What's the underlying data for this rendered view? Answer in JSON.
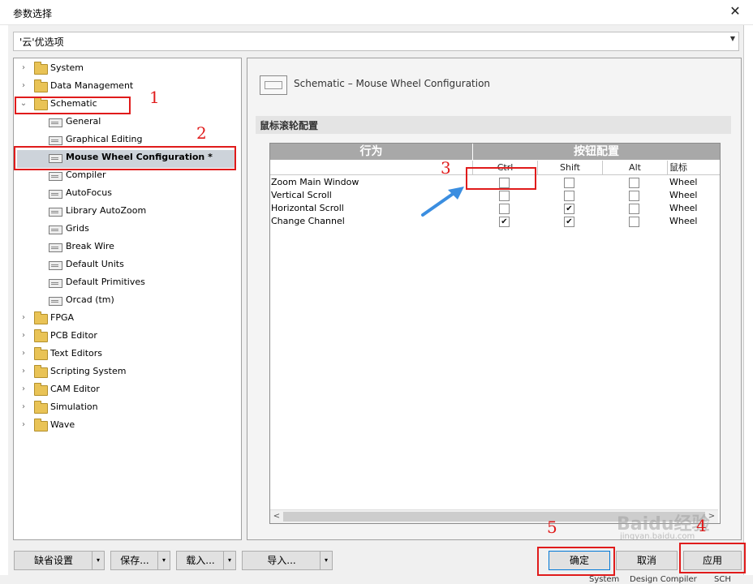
{
  "window": {
    "title": "参数选择",
    "close_glyph": "✕"
  },
  "cloud_selector": {
    "value": "'云'优选项"
  },
  "tree": [
    {
      "label": "System",
      "level": 0,
      "type": "folder",
      "expanded": false
    },
    {
      "label": "Data Management",
      "level": 0,
      "type": "folder",
      "expanded": false
    },
    {
      "label": "Schematic",
      "level": 0,
      "type": "folder",
      "expanded": true
    },
    {
      "label": "General",
      "level": 1,
      "type": "page"
    },
    {
      "label": "Graphical Editing",
      "level": 1,
      "type": "page"
    },
    {
      "label": "Mouse Wheel Configuration *",
      "level": 1,
      "type": "page",
      "selected": true
    },
    {
      "label": "Compiler",
      "level": 1,
      "type": "page"
    },
    {
      "label": "AutoFocus",
      "level": 1,
      "type": "page"
    },
    {
      "label": "Library AutoZoom",
      "level": 1,
      "type": "page"
    },
    {
      "label": "Grids",
      "level": 1,
      "type": "page"
    },
    {
      "label": "Break Wire",
      "level": 1,
      "type": "page"
    },
    {
      "label": "Default Units",
      "level": 1,
      "type": "page"
    },
    {
      "label": "Default Primitives",
      "level": 1,
      "type": "page"
    },
    {
      "label": "Orcad (tm)",
      "level": 1,
      "type": "page"
    },
    {
      "label": "FPGA",
      "level": 0,
      "type": "folder",
      "expanded": false
    },
    {
      "label": "PCB Editor",
      "level": 0,
      "type": "folder",
      "expanded": false
    },
    {
      "label": "Text Editors",
      "level": 0,
      "type": "folder",
      "expanded": false
    },
    {
      "label": "Scripting System",
      "level": 0,
      "type": "folder",
      "expanded": false
    },
    {
      "label": "CAM Editor",
      "level": 0,
      "type": "folder",
      "expanded": false
    },
    {
      "label": "Simulation",
      "level": 0,
      "type": "folder",
      "expanded": false
    },
    {
      "label": "Wave",
      "level": 0,
      "type": "folder",
      "expanded": false
    }
  ],
  "panel": {
    "header_title": "Schematic – Mouse Wheel Configuration",
    "section_title": "鼠标滚轮配置",
    "group_headers": {
      "action": "行为",
      "buttons": "按钮配置"
    },
    "columns": {
      "ctrl": "Ctrl",
      "shift": "Shift",
      "alt": "Alt",
      "mouse": "鼠标"
    },
    "rows": [
      {
        "action": "Zoom Main Window",
        "ctrl": false,
        "shift": false,
        "alt": false,
        "mouse": "Wheel"
      },
      {
        "action": "Vertical Scroll",
        "ctrl": false,
        "shift": false,
        "alt": false,
        "mouse": "Wheel"
      },
      {
        "action": "Horizontal Scroll",
        "ctrl": false,
        "shift": true,
        "alt": false,
        "mouse": "Wheel"
      },
      {
        "action": "Change Channel",
        "ctrl": true,
        "shift": true,
        "alt": false,
        "mouse": "Wheel"
      }
    ],
    "check_glyph": "✔"
  },
  "buttons": {
    "defaults": "缺省设置",
    "save": "保存...",
    "load": "载入...",
    "import": "导入...",
    "ok": "确定",
    "cancel": "取消",
    "apply": "应用",
    "dropdown_glyph": "▾"
  },
  "annotations": {
    "n1": "1",
    "n2": "2",
    "n3": "3",
    "n4": "4",
    "n5": "5"
  },
  "status_bar": [
    "System",
    "Design Compiler",
    "SCH"
  ],
  "watermark": {
    "big": "Baidu经验",
    "small": "jingyan.baidu.com"
  },
  "colors": {
    "annotation_red": "#e01b1b",
    "arrow_blue": "#3b8ee0",
    "grid_header": "#a8a8a8",
    "selection": "#cdd3da"
  }
}
